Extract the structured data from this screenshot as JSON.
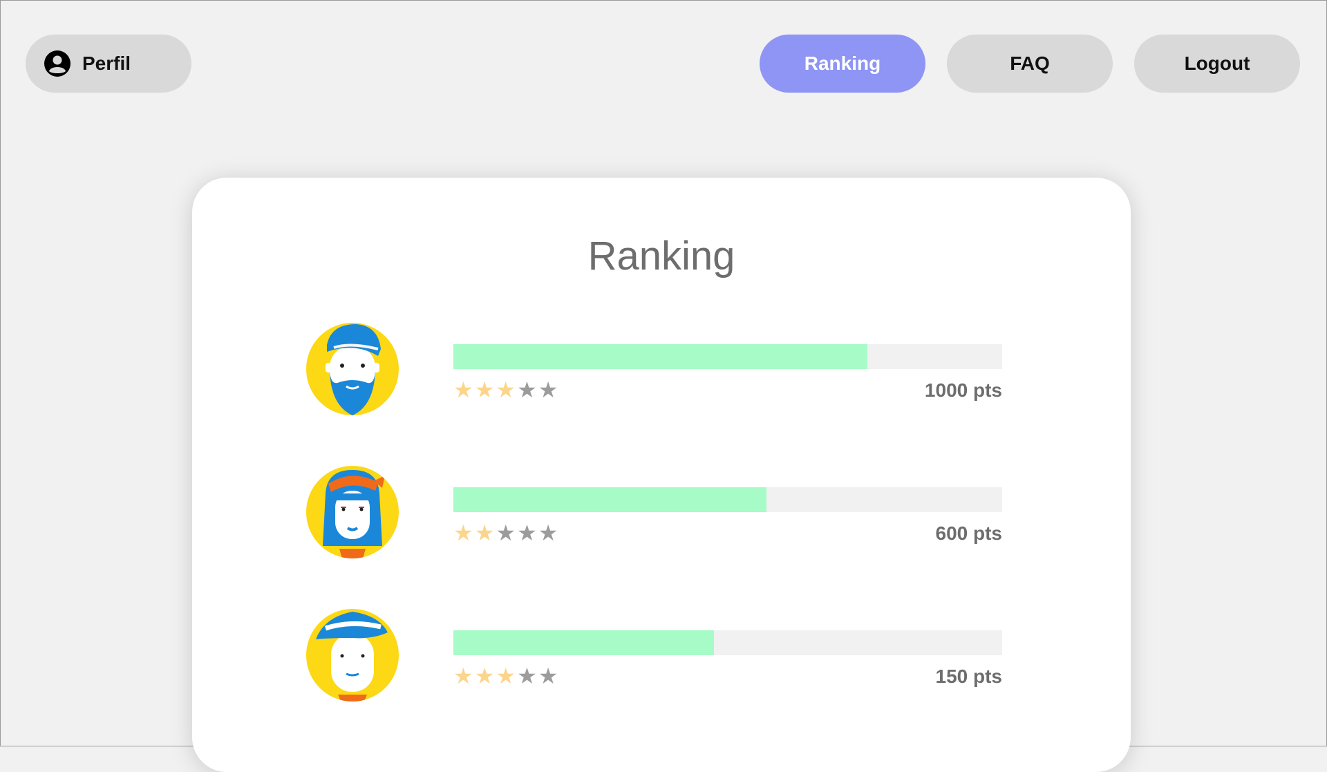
{
  "nav": {
    "perfil_label": "Perfil",
    "ranking_label": "Ranking",
    "faq_label": "FAQ",
    "logout_label": "Logout",
    "active_tab": "Ranking"
  },
  "colors": {
    "page_bg": "#f1f1f1",
    "nav_button_bg": "#d9d9d9",
    "nav_active_bg": "#8e95f4",
    "bar_fill": "#a6fbc6",
    "bar_track": "#f1f1f1",
    "star_filled": "#fcd58d",
    "star_empty": "#9c9c9c",
    "avatar_circle": "#fcd815",
    "avatar_blue": "#1b87d8"
  },
  "ranking": {
    "title": "Ranking",
    "entries": [
      {
        "avatar": "bearded-man-cap-avatar",
        "progress": 0.755,
        "stars": 3,
        "max_stars": 5,
        "points": "1000 pts"
      },
      {
        "avatar": "woman-headband-avatar",
        "progress": 0.57,
        "stars": 2,
        "max_stars": 5,
        "points": "600 pts"
      },
      {
        "avatar": "boy-hat-avatar",
        "progress": 0.475,
        "stars": 3,
        "max_stars": 5,
        "points": "150 pts"
      }
    ]
  }
}
